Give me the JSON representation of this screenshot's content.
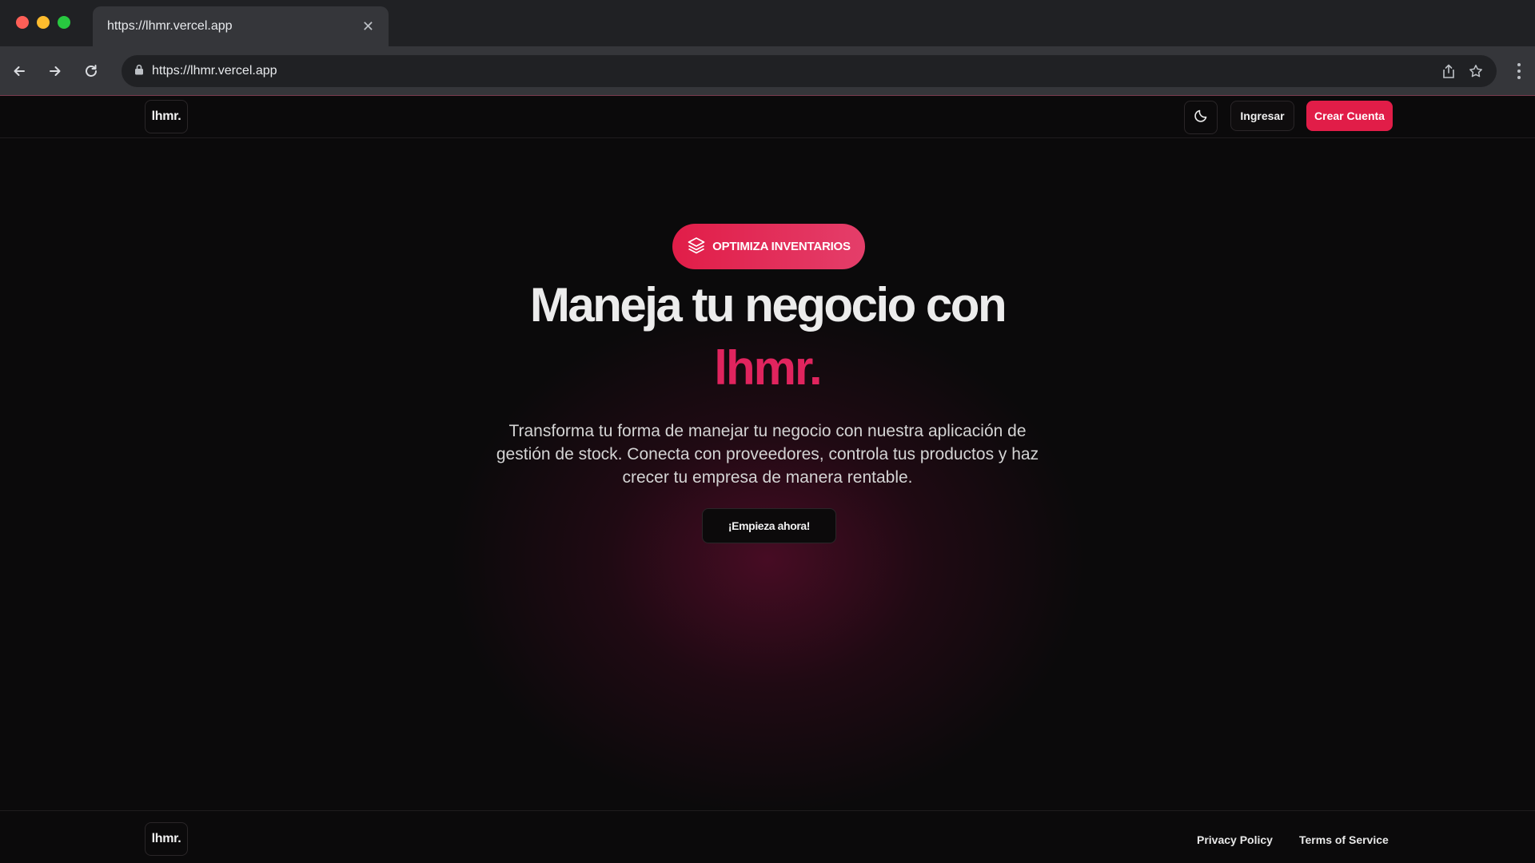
{
  "browser": {
    "tab_title": "https://lhmr.vercel.app",
    "url": "https://lhmr.vercel.app",
    "icons": [
      "back-arrow-icon",
      "forward-arrow-icon",
      "reload-icon",
      "lock-icon",
      "share-icon",
      "star-icon",
      "kebab-menu-icon",
      "close-icon"
    ]
  },
  "header": {
    "logo": "lhmr.",
    "login_label": "Ingresar",
    "signup_label": "Crear Cuenta",
    "theme_icon": "moon-icon"
  },
  "hero": {
    "badge_label": "OPTIMIZA INVENTARIOS",
    "badge_icon": "layers-icon",
    "headline": "Maneja tu negocio con",
    "brand_word": "lhmr.",
    "subtitle": "Transforma tu forma de manejar tu negocio con nuestra aplicación de gestión de stock. Conecta con proveedores, controla tus productos y haz crecer tu empresa de manera rentable.",
    "cta_label": "¡Empieza ahora!"
  },
  "footer": {
    "logo": "lhmr.",
    "privacy_label": "Privacy Policy",
    "terms_label": "Terms of Service"
  },
  "colors": {
    "accent": "#e11d48",
    "background": "#0b0a0b",
    "brand_text": "#e0245e"
  }
}
